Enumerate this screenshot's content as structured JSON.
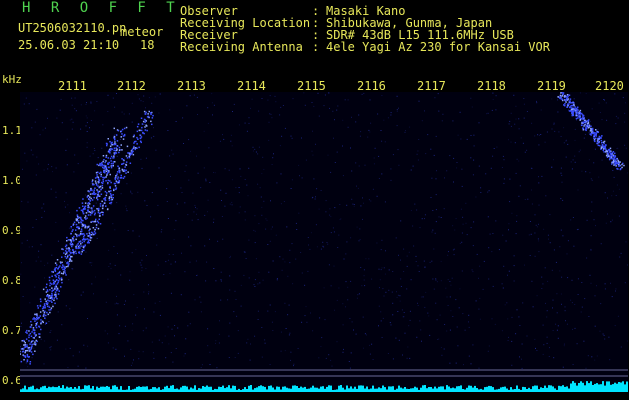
{
  "header": {
    "brand": "H R O F F T",
    "filename": "UT2506032110.pn",
    "filename_suffix": "meteor",
    "datetime": "25.06.03 21:10",
    "count": "18"
  },
  "meta": [
    {
      "key": "Observer",
      "value": "Masaki Kano"
    },
    {
      "key": "Receiving Location",
      "value": "Shibukawa, Gunma, Japan"
    },
    {
      "key": "Receiver",
      "value": "SDR# 43dB L15 111.6MHz USB"
    },
    {
      "key": "Receiving Antenna",
      "value": "4ele Yagi Az 230 for Kansai VOR"
    }
  ],
  "plot": {
    "y_unit": "kHz",
    "y_ticks": [
      "1.1",
      "1.0",
      "0.9",
      "0.8",
      "0.7",
      "0.6"
    ],
    "x_ticks": [
      "2111",
      "2112",
      "2113",
      "2114",
      "2115",
      "2116",
      "2117",
      "2118",
      "2119",
      "2120"
    ],
    "colors": {
      "background": "#000010",
      "signal": "#3a4dff",
      "strong_signal": "#8fa5ff",
      "power_bar": "#00e5ff",
      "text": "#e7e75a",
      "brand": "#4fd34f"
    }
  }
}
